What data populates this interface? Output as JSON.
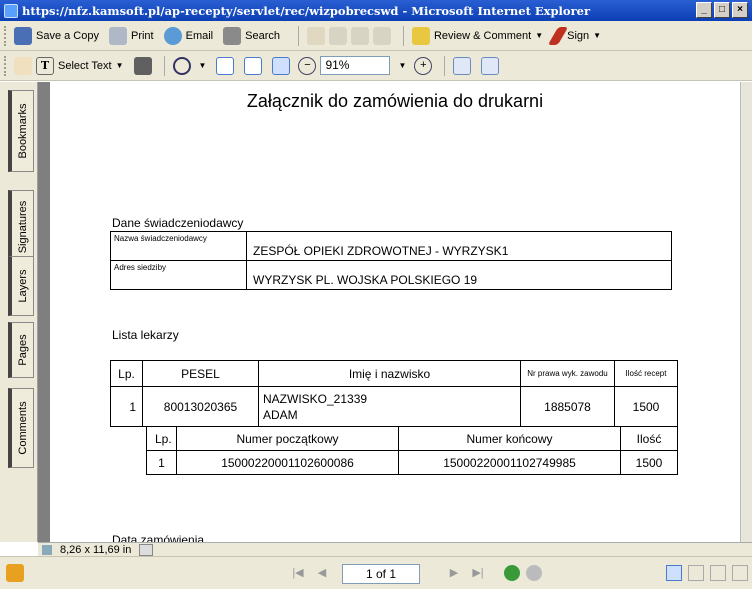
{
  "window": {
    "title": "https://nfz.kamsoft.pl/ap-recepty/servlet/rec/wizpobrecswd - Microsoft Internet Explorer"
  },
  "toolbar1": {
    "save_copy": "Save a Copy",
    "print": "Print",
    "email": "Email",
    "search": "Search",
    "review": "Review & Comment",
    "sign": "Sign"
  },
  "toolbar2": {
    "select_text": "Select Text",
    "zoom": "91%"
  },
  "nav_tabs": [
    "Bookmarks",
    "Signatures",
    "Layers",
    "Pages",
    "Comments"
  ],
  "document": {
    "title": "Załącznik do zamówienia do drukarni",
    "provider_section": "Dane świadczeniodawcy",
    "provider": {
      "name_label": "Nazwa świadczeniodawcy",
      "name_value": "ZESPÓŁ OPIEKI ZDROWOTNEJ - WYRZYSK1",
      "address_label": "Adres siedziby",
      "address_value": "WYRZYSK PL. WOJSKA POLSKIEGO 19"
    },
    "doctors_section": "Lista lekarzy",
    "doctors_headers": {
      "lp": "Lp.",
      "pesel": "PESEL",
      "name": "Imię i nazwisko",
      "license": "Nr prawa wyk. zawodu",
      "count": "Ilość recept"
    },
    "doctor_row": {
      "lp": "1",
      "pesel": "80013020365",
      "name1": "NAZWISKO_21339",
      "name2": "ADAM",
      "license": "1885078",
      "count": "1500"
    },
    "range_headers": {
      "lp": "Lp.",
      "start": "Numer początkowy",
      "end": "Numer końcowy",
      "count": "Ilość"
    },
    "range_row": {
      "lp": "1",
      "start": "15000220001102600086",
      "end": "15000220001102749985",
      "count": "1500"
    },
    "order_date_label": "Data zamówienia"
  },
  "status": {
    "page_size": "8,26 x 11,69 in",
    "page_indicator": "1 of 1"
  }
}
